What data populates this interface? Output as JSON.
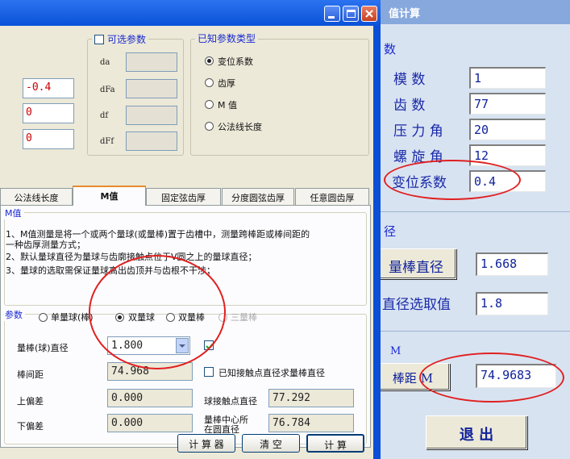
{
  "back_window": {
    "title": "值计算",
    "section_params": "数",
    "labels": {
      "module": "模   数",
      "teeth": "齿   数",
      "pressure_angle": "压 力 角",
      "helix_angle": "螺 旋 角",
      "shift_coef": "变位系数"
    },
    "values": {
      "module": "1",
      "teeth": "77",
      "pressure_angle": "20",
      "helix_angle": "12",
      "shift_coef": "0.4"
    },
    "section_dia": "径",
    "rod_dia_button": "量棒直径",
    "rod_dia_value": "1.668",
    "dia_choice_label": "直径选取值",
    "dia_choice_value": "1.8",
    "section_m": "M",
    "dist_button": "棒距 M",
    "dist_value": "74.9683",
    "exit_button": "退  出"
  },
  "front_window": {
    "shift_values": [
      "-0.4",
      "0",
      "0"
    ],
    "optional_group": {
      "title": "可选参数",
      "labels": [
        "da",
        "dFa",
        "df",
        "dFf"
      ]
    },
    "known_group": {
      "title": "已知参数类型",
      "options": [
        "变位系数",
        "齿厚",
        "M 值",
        "公法线长度"
      ],
      "selected": 0
    },
    "tabs": [
      "公法线长度",
      "M值",
      "固定弦齿厚",
      "分度圆弦齿厚",
      "任意圆齿厚"
    ],
    "active_tab": 1,
    "m_section": {
      "title": "M值",
      "notes": [
        "1、M值测量是将一个或两个量球(或量棒)置于齿槽中，测量跨棒距或棒间距的",
        "    一种齿厚测量方式；",
        "2、默认量球直径为量球与齿廓接触点位于V圆之上的量球直径；",
        "3、量球的选取需保证量球高出齿顶并与齿根不干涉；"
      ]
    },
    "params": {
      "title": "参数",
      "radio_options": [
        "单量球(棒)",
        "双量球",
        "双量棒",
        "三量棒"
      ],
      "radio_selected": 1,
      "ball_dia_label": "量棒(球)直径",
      "ball_dia_value": "1.800",
      "ball_dia_checked": true,
      "rod_dist_label": "棒间距",
      "rod_dist_value": "74.968",
      "known_contact_label": "已知接触点直径求量棒直径",
      "upper_dev_label": "上偏差",
      "upper_dev_value": "0.000",
      "lower_dev_label": "下偏差",
      "lower_dev_value": "0.000",
      "contact_dia_label": "球接触点直径",
      "contact_dia_value": "77.292",
      "center_dia_label_1": "量棒中心所",
      "center_dia_label_2": "在圆直径",
      "center_dia_value": "76.784"
    },
    "buttons": {
      "calculator": "计 算 器",
      "clear": "清  空",
      "compute": "计  算"
    }
  }
}
